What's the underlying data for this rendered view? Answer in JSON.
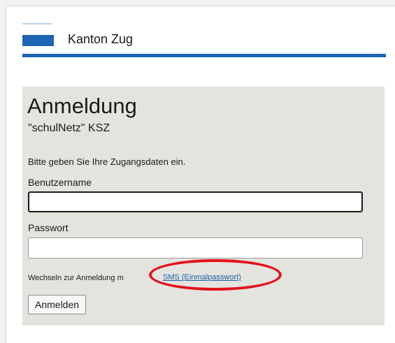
{
  "header": {
    "org_name": "Kanton Zug"
  },
  "login": {
    "title": "Anmeldung",
    "subtitle": "\"schulNetz\" KSZ",
    "instruction": "Bitte geben Sie Ihre Zugangsdaten ein.",
    "username_label": "Benutzername",
    "username_value": "",
    "password_label": "Passwort",
    "password_value": "",
    "switch_text": "Wechseln zur Anmeldung m",
    "sms_link": "SMS (Einmalpasswort)",
    "submit_label": "Anmelden"
  },
  "colors": {
    "brand_blue": "#1e64b4",
    "panel_bg": "#e4e4df",
    "highlight_red": "#e3121b",
    "link": "#1a5fa8"
  }
}
